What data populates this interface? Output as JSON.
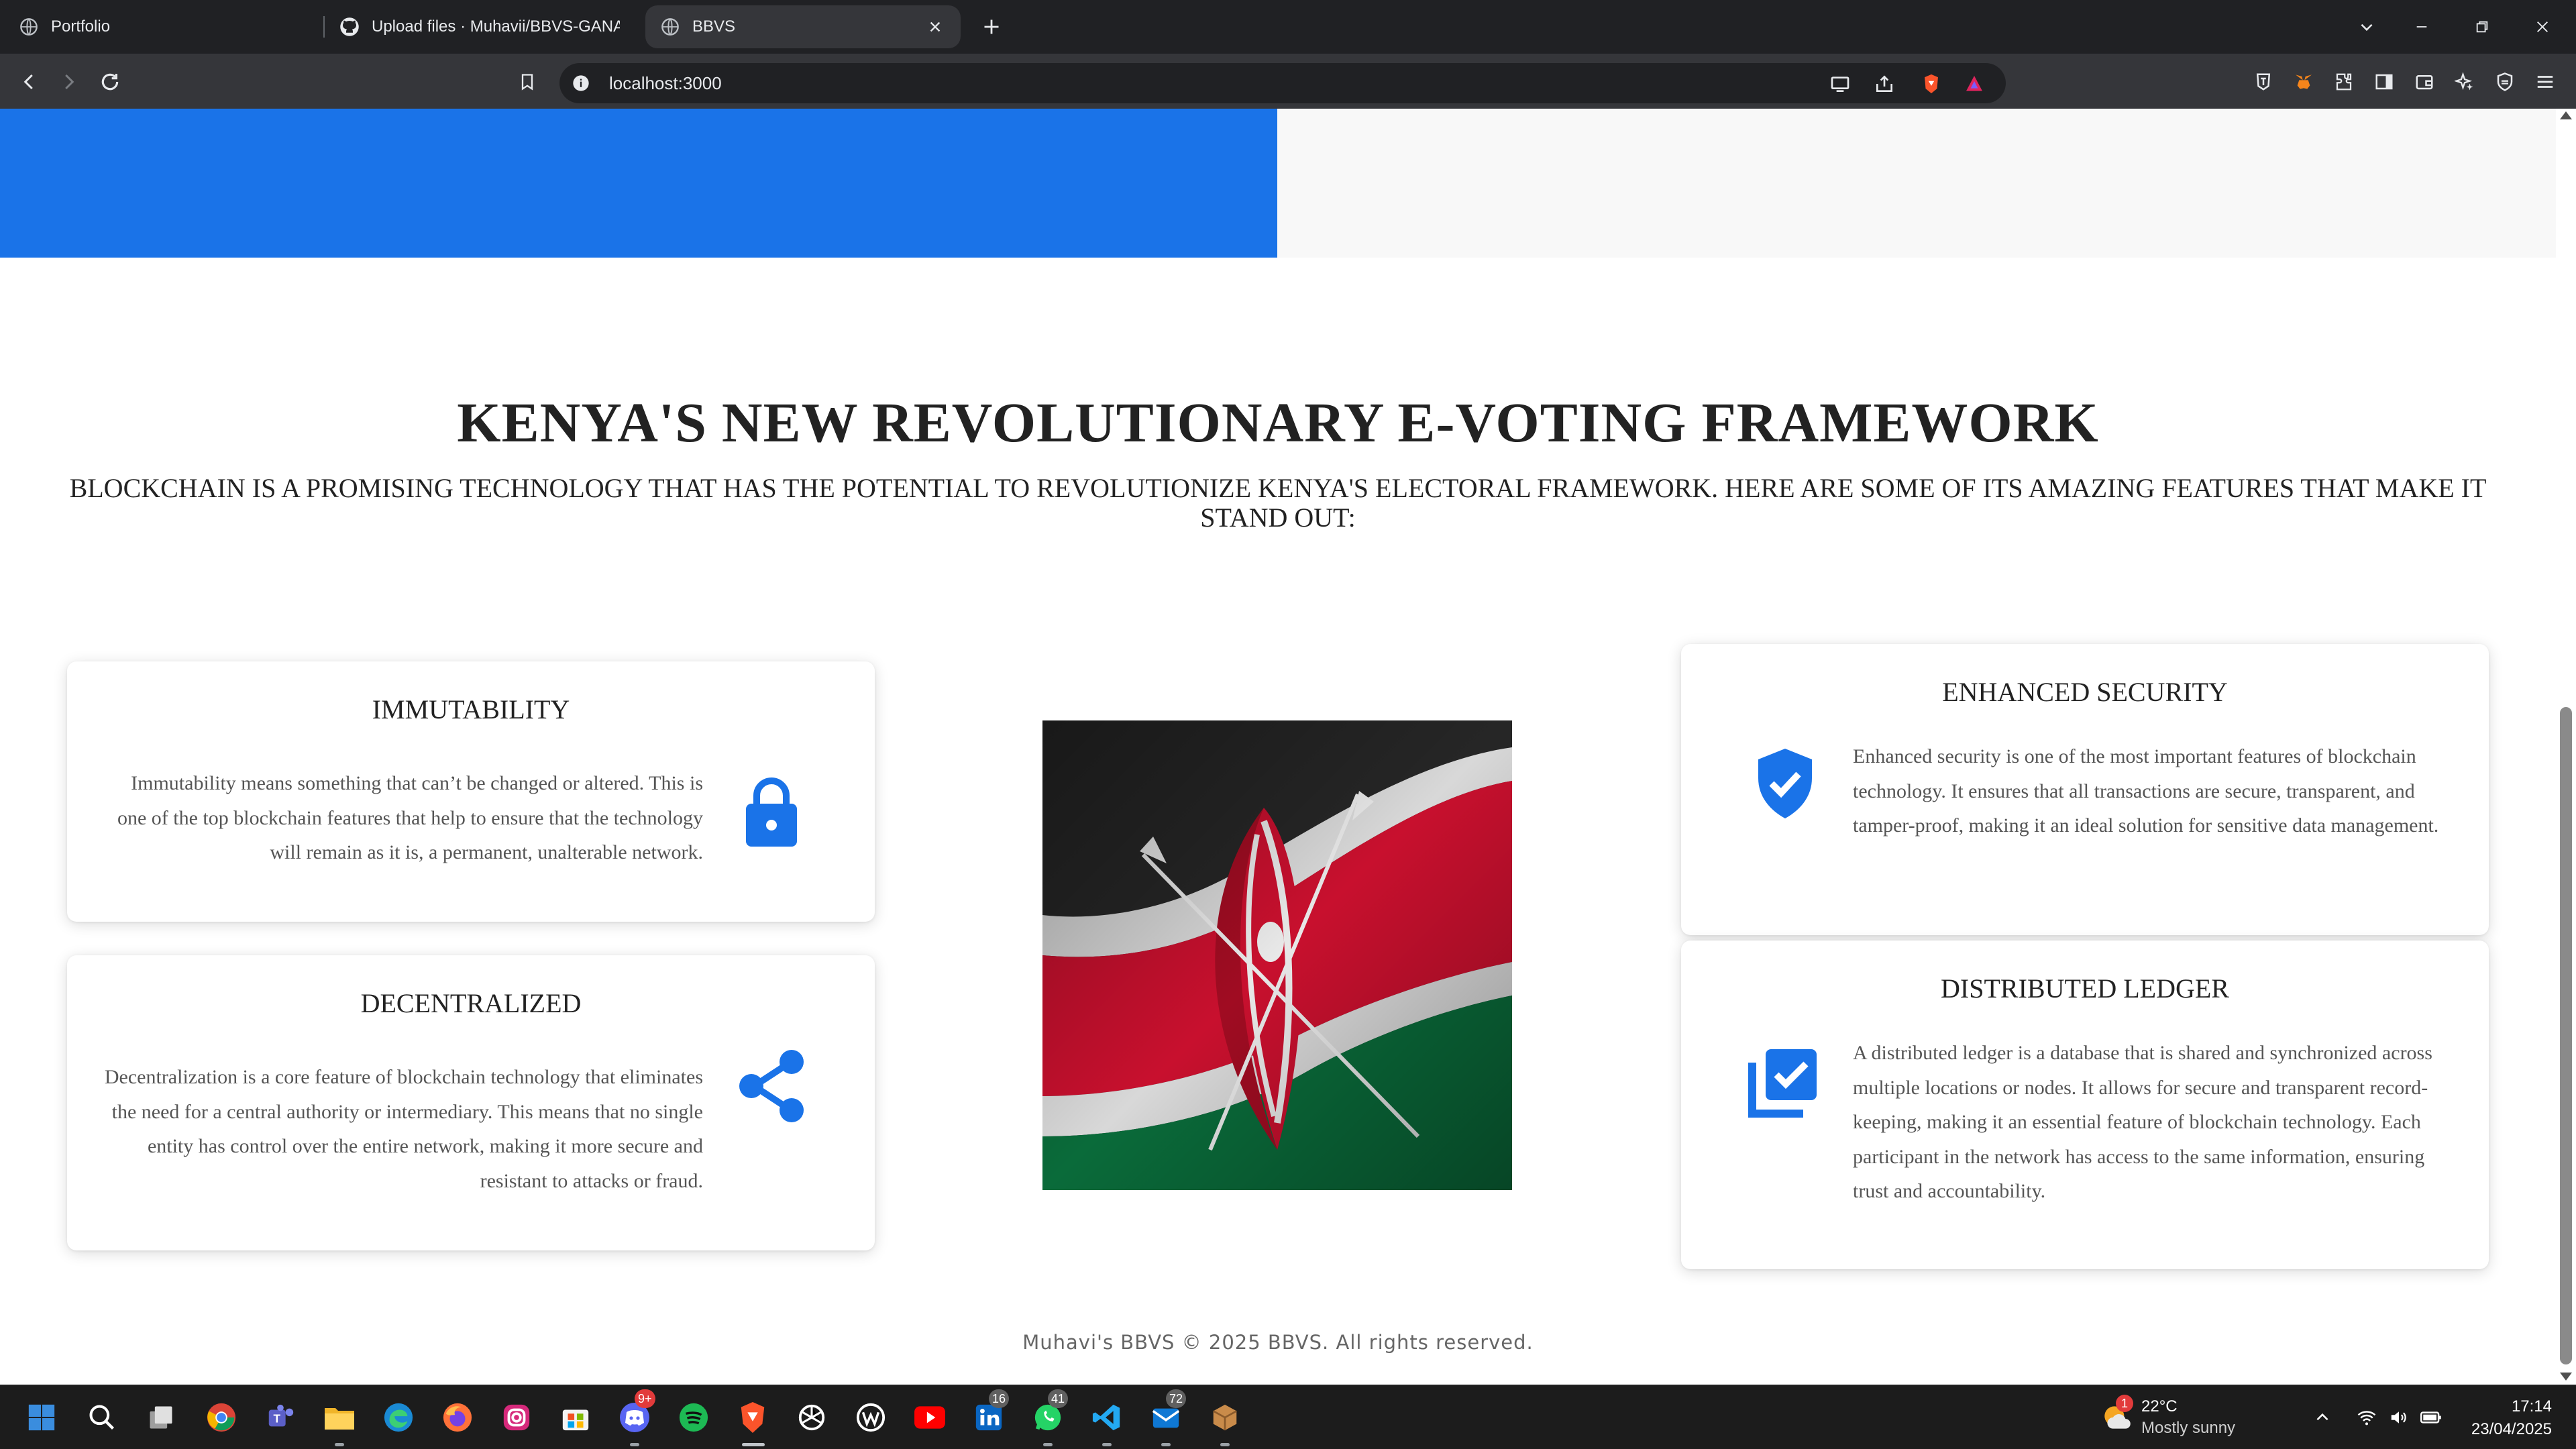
{
  "browser": {
    "tabs": [
      {
        "label": "Portfolio",
        "icon": "globe-icon",
        "active": false
      },
      {
        "label": "Upload files · Muhavii/BBVS-GANACHE",
        "icon": "github-icon",
        "active": false
      },
      {
        "label": "BBVS",
        "icon": "globe-icon",
        "active": true
      }
    ],
    "url": "localhost:3000"
  },
  "page": {
    "title": "KENYA'S NEW REVOLUTIONARY E-VOTING FRAMEWORK",
    "subtitle": "BLOCKCHAIN IS A PROMISING TECHNOLOGY THAT HAS THE POTENTIAL TO REVOLUTIONIZE KENYA'S ELECTORAL FRAMEWORK. HERE ARE SOME OF ITS AMAZING FEATURES THAT MAKE IT STAND OUT:",
    "features": {
      "immutability": {
        "title": "IMMUTABILITY",
        "text": "Immutability means something that can’t be changed or altered. This is one of the top blockchain features that help to ensure that the technology will remain as it is, a permanent, unalterable network.",
        "icon": "lock-icon"
      },
      "decentralized": {
        "title": "DECENTRALIZED",
        "text": "Decentralization is a core feature of blockchain technology that eliminates the need for a central authority or intermediary. This means that no single entity has control over the entire network, making it more secure and resistant to attacks or fraud.",
        "icon": "share-icon"
      },
      "security": {
        "title": "ENHANCED SECURITY",
        "text": "Enhanced security is one of the most important features of blockchain technology. It ensures that all transactions are secure, transparent, and tamper-proof, making it an ideal solution for sensitive data management.",
        "icon": "shield-check-icon"
      },
      "ledger": {
        "title": "DISTRIBUTED LEDGER",
        "text": "A distributed ledger is a database that is shared and synchronized across multiple locations or nodes. It allows for secure and transparent record-keeping, making it an essential feature of blockchain technology. Each participant in the network has access to the same information, ensuring trust and accountability.",
        "icon": "library-add-check-icon"
      }
    },
    "footer": "Muhavi's BBVS © 2025 BBVS. All rights reserved.",
    "colors": {
      "accent": "#1a73e8",
      "icon": "#1a73e8"
    }
  },
  "taskbar": {
    "badges": {
      "discord": "9+",
      "linkedin": "16",
      "whatsapp": "41",
      "mail": "72"
    },
    "weather": {
      "temp": "22°C",
      "desc": "Mostly sunny",
      "alert": "1"
    },
    "clock": {
      "time": "17:14",
      "date": "23/04/2025"
    }
  }
}
